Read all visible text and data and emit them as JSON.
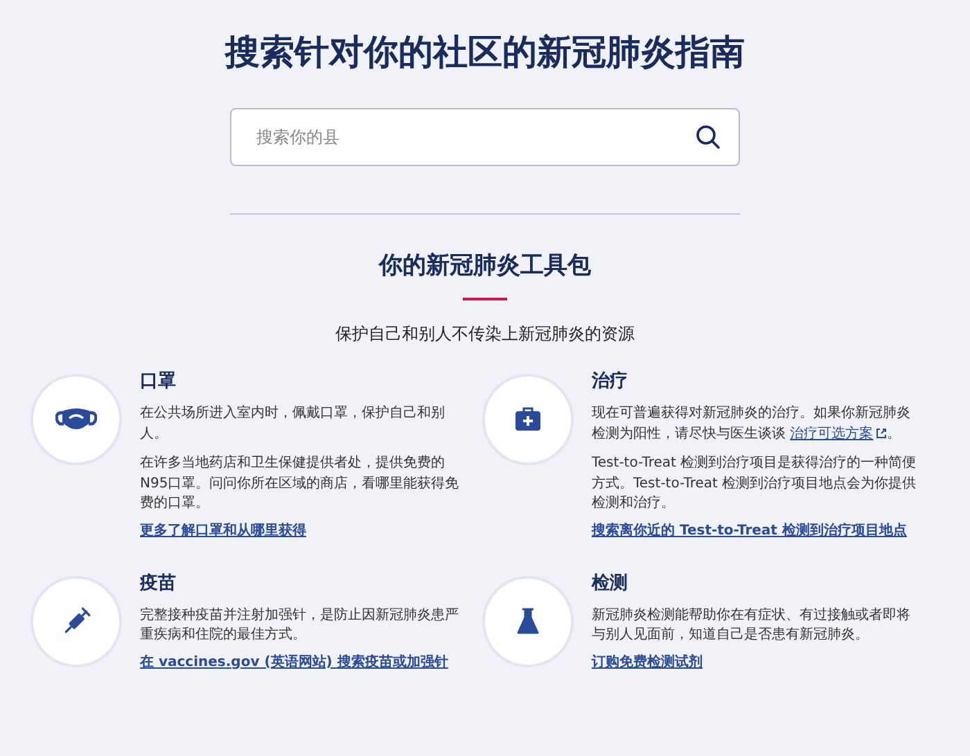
{
  "title": "搜索针对你的社区的新冠肺炎指南",
  "search": {
    "placeholder": "搜索你的县"
  },
  "toolkit": {
    "heading": "你的新冠肺炎工具包",
    "subtitle": "保护自己和别人不传染上新冠肺炎的资源"
  },
  "cards": [
    {
      "kind": "mask",
      "title": "口罩",
      "paragraphs": [
        {
          "text": "在公共场所进入室内时，佩戴口罩，保护自己和别人。"
        },
        {
          "text": "在许多当地药店和卫生保健提供者处，提供免费的N95口罩。问问你所在区域的商店，看哪里能获得免费的口罩。"
        }
      ],
      "link": "更多了解口罩和从哪里获得"
    },
    {
      "kind": "treatment",
      "title": "治疗",
      "paragraphs": [
        {
          "text": "现在可普遍获得对新冠肺炎的治疗。如果你新冠肺炎检测为阳性，请尽快与医生谈谈 ",
          "link": "治疗可选方案",
          "after": "。"
        },
        {
          "text": "Test-to-Treat 检测到治疗项目是获得治疗的一种简便方式。Test-to-Treat 检测到治疗项目地点会为你提供检测和治疗。"
        }
      ],
      "link": "搜索离你近的 Test-to-Treat 检测到治疗项目地点"
    },
    {
      "kind": "vaccine",
      "title": "疫苗",
      "paragraphs": [
        {
          "text": "完整接种疫苗并注射加强针，是防止因新冠肺炎患严重疾病和住院的最佳方式。"
        }
      ],
      "link": "在 vaccines.gov (英语网站) 搜索疫苗或加强针"
    },
    {
      "kind": "test",
      "title": "检测",
      "paragraphs": [
        {
          "text": "新冠肺炎检测能帮助你在有症状、有过接触或者即将与别人见面前，知道自己是否患有新冠肺炎。"
        }
      ],
      "link": "订购免费检测试剂"
    }
  ]
}
